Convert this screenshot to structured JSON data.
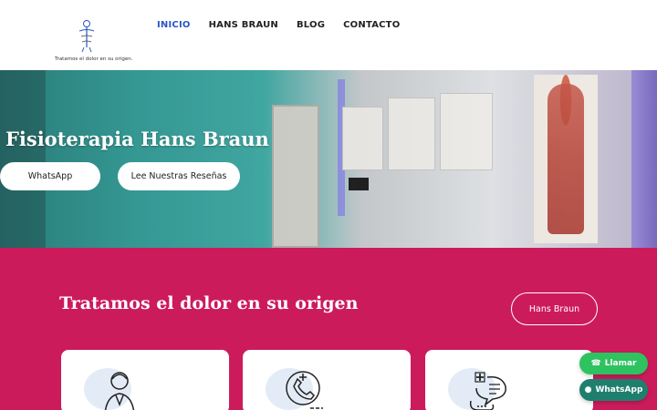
{
  "header": {
    "logo_tagline": "Tratamos el dolor en su origen.",
    "logo_icon": "spine-figure-icon",
    "nav": [
      {
        "label": "INICIO",
        "active": true
      },
      {
        "label": "HANS BRAUN",
        "active": false
      },
      {
        "label": "BLOG",
        "active": false
      },
      {
        "label": "CONTACTO",
        "active": false
      }
    ]
  },
  "hero": {
    "title": "Fisioterapia Hans Braun",
    "buttons": {
      "whatsapp": "WhatsApp",
      "reviews": "Lee Nuestras Reseñas"
    }
  },
  "section": {
    "title": "Tratamos el dolor en su origen",
    "button": "Hans Braun",
    "background": "#cc1b5b",
    "cards": [
      {
        "icon": "doctor-icon"
      },
      {
        "icon": "phone-medical-icon"
      },
      {
        "icon": "chat-medical-icon"
      }
    ]
  },
  "floating": {
    "call": {
      "label": "Llamar",
      "icon": "phone-icon",
      "color": "#2ec260"
    },
    "whatsapp": {
      "label": "WhatsApp",
      "icon": "chat-icon",
      "color": "#1f7f6e"
    }
  },
  "colors": {
    "nav_active": "#2a55c5",
    "accent_pink": "#cc1b5b"
  }
}
